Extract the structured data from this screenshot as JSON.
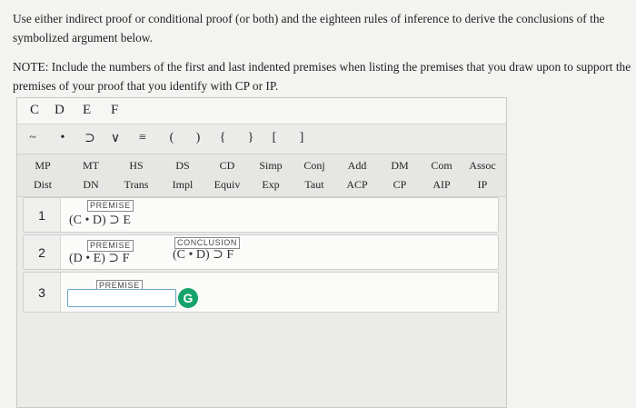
{
  "instructions": {
    "line1": "Use either indirect proof or conditional proof (or both) and the eighteen rules of inference to derive the conclusions of the",
    "line2": "symbolized argument below.",
    "note1": "NOTE: Include the numbers of the first and last indented premises when listing the premises that you draw upon to support the",
    "note2": "premises of your proof that you identify with CP or IP."
  },
  "letters": [
    "C",
    "D",
    "E",
    "F"
  ],
  "symbols": [
    "~",
    "•",
    "⊃",
    "∨",
    "≡",
    "(",
    ")",
    "{",
    "}",
    "[",
    "]"
  ],
  "rules_row1": [
    "MP",
    "MT",
    "HS",
    "DS",
    "CD",
    "Simp",
    "Conj",
    "Add",
    "DM",
    "Com",
    "Assoc"
  ],
  "rules_row2": [
    "Dist",
    "DN",
    "Trans",
    "Impl",
    "Equiv",
    "Exp",
    "Taut",
    "ACP",
    "CP",
    "AIP",
    "IP"
  ],
  "lines": [
    {
      "num": "1",
      "tag": "PREMISE",
      "formula": "(C • D) ⊃ E"
    },
    {
      "num": "2",
      "tag": "PREMISE",
      "formula": "(D • E) ⊃ F",
      "conclusion_tag": "CONCLUSION",
      "conclusion": "(C • D) ⊃ F"
    },
    {
      "num": "3",
      "tag": "PREMISE",
      "input_value": ""
    }
  ],
  "grammarly_letter": "G"
}
